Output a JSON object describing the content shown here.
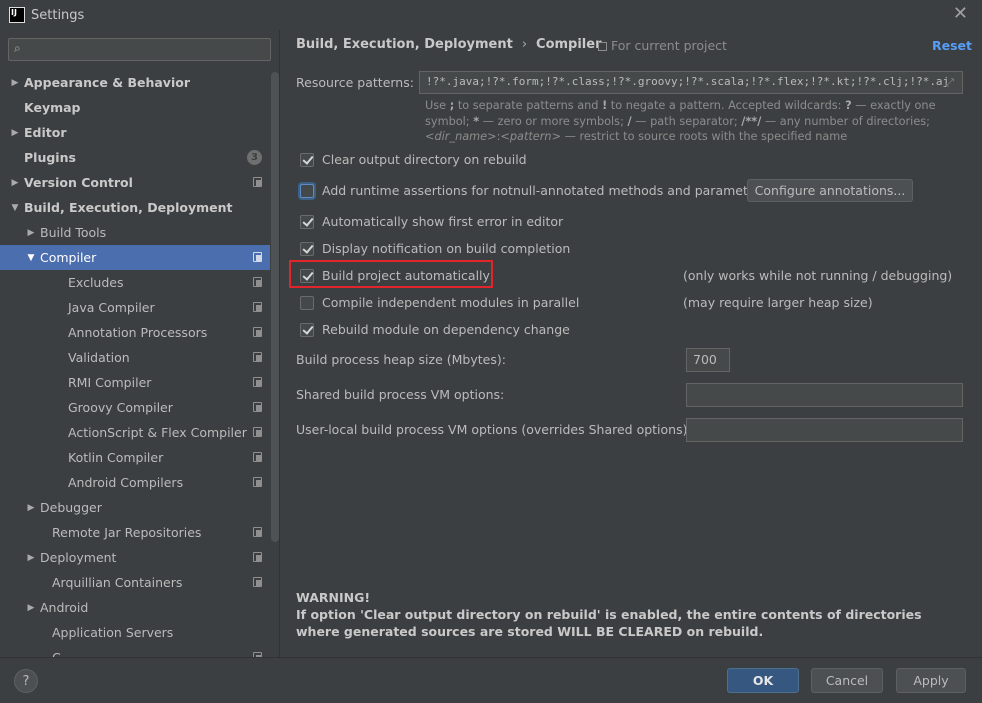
{
  "window": {
    "title": "Settings",
    "app_icon_text": "IJ"
  },
  "search": {
    "placeholder": "",
    "value": ""
  },
  "sidebar": {
    "items": [
      {
        "label": "Appearance & Behavior",
        "arrow": "▶",
        "bold": true
      },
      {
        "label": "Keymap",
        "arrow": "",
        "bold": true
      },
      {
        "label": "Editor",
        "arrow": "▶",
        "bold": true
      },
      {
        "label": "Plugins",
        "arrow": "",
        "bold": true,
        "badge": "3"
      },
      {
        "label": "Version Control",
        "arrow": "▶",
        "bold": true
      },
      {
        "label": "Build, Execution, Deployment",
        "arrow": "▼",
        "bold": true
      },
      {
        "label": "Build Tools",
        "arrow": "▶"
      },
      {
        "label": "Compiler",
        "arrow": "▼",
        "selected": true
      },
      {
        "label": "Excludes"
      },
      {
        "label": "Java Compiler"
      },
      {
        "label": "Annotation Processors"
      },
      {
        "label": "Validation"
      },
      {
        "label": "RMI Compiler"
      },
      {
        "label": "Groovy Compiler"
      },
      {
        "label": "ActionScript & Flex Compiler"
      },
      {
        "label": "Kotlin Compiler"
      },
      {
        "label": "Android Compilers"
      },
      {
        "label": "Debugger",
        "arrow": "▶"
      },
      {
        "label": "Remote Jar Repositories"
      },
      {
        "label": "Deployment",
        "arrow": "▶"
      },
      {
        "label": "Arquillian Containers"
      },
      {
        "label": "Android",
        "arrow": "▶"
      },
      {
        "label": "Application Servers"
      },
      {
        "label": "C..."
      }
    ]
  },
  "header": {
    "crumb_parent": "Build, Execution, Deployment",
    "crumb_sep": "›",
    "crumb_current": "Compiler",
    "scope": "For current project",
    "reset": "Reset"
  },
  "resource_patterns": {
    "label": "Resource patterns:",
    "value": "!?*.java;!?*.form;!?*.class;!?*.groovy;!?*.scala;!?*.flex;!?*.kt;!?*.clj;!?*.aj",
    "hint_1": "Use ",
    "hint_semi": ";",
    "hint_2": " to separate patterns and ",
    "hint_bang": "!",
    "hint_3": " to negate a pattern. Accepted wildcards: ",
    "hint_q": "?",
    "hint_4": " — exactly one symbol; ",
    "hint_star": "*",
    "hint_5": " — zero or more symbols; ",
    "hint_slash": "/",
    "hint_6": " — path separator; ",
    "hint_dstar": "/**/",
    "hint_7": " — any number of directories; ",
    "hint_dir": "<dir_name>",
    "hint_colon": ":",
    "hint_pattern": "<pattern>",
    "hint_8": " — restrict to source roots with the specified name"
  },
  "options": {
    "clear_output": {
      "label": "Clear output directory on rebuild",
      "checked": true
    },
    "runtime_assertions": {
      "label": "Add runtime assertions for notnull-annotated methods and parameters",
      "checked": false
    },
    "configure_annotations": "Configure annotations...",
    "show_first_error": {
      "label": "Automatically show first error in editor",
      "checked": true
    },
    "display_notification": {
      "label": "Display notification on build completion",
      "checked": true
    },
    "build_auto": {
      "label": "Build project automatically",
      "checked": true,
      "note": "(only works while not running / debugging)"
    },
    "compile_parallel": {
      "label": "Compile independent modules in parallel",
      "checked": false,
      "note": "(may require larger heap size)"
    },
    "rebuild_module": {
      "label": "Rebuild module on dependency change",
      "checked": true
    }
  },
  "heap": {
    "label": "Build process heap size (Mbytes):",
    "value": "700"
  },
  "shared_vm": {
    "label": "Shared build process VM options:",
    "value": ""
  },
  "user_vm": {
    "label": "User-local build process VM options (overrides Shared options):",
    "value": ""
  },
  "warning": {
    "title": "WARNING!",
    "text": "If option 'Clear output directory on rebuild' is enabled, the entire contents of directories where generated sources are stored WILL BE CLEARED on rebuild."
  },
  "footer": {
    "help": "?",
    "ok": "OK",
    "cancel": "Cancel",
    "apply": "Apply"
  },
  "colors": {
    "accent": "#4b6eaf",
    "link": "#589df6",
    "highlight": "#e0262a",
    "ok_button": "#365880"
  }
}
